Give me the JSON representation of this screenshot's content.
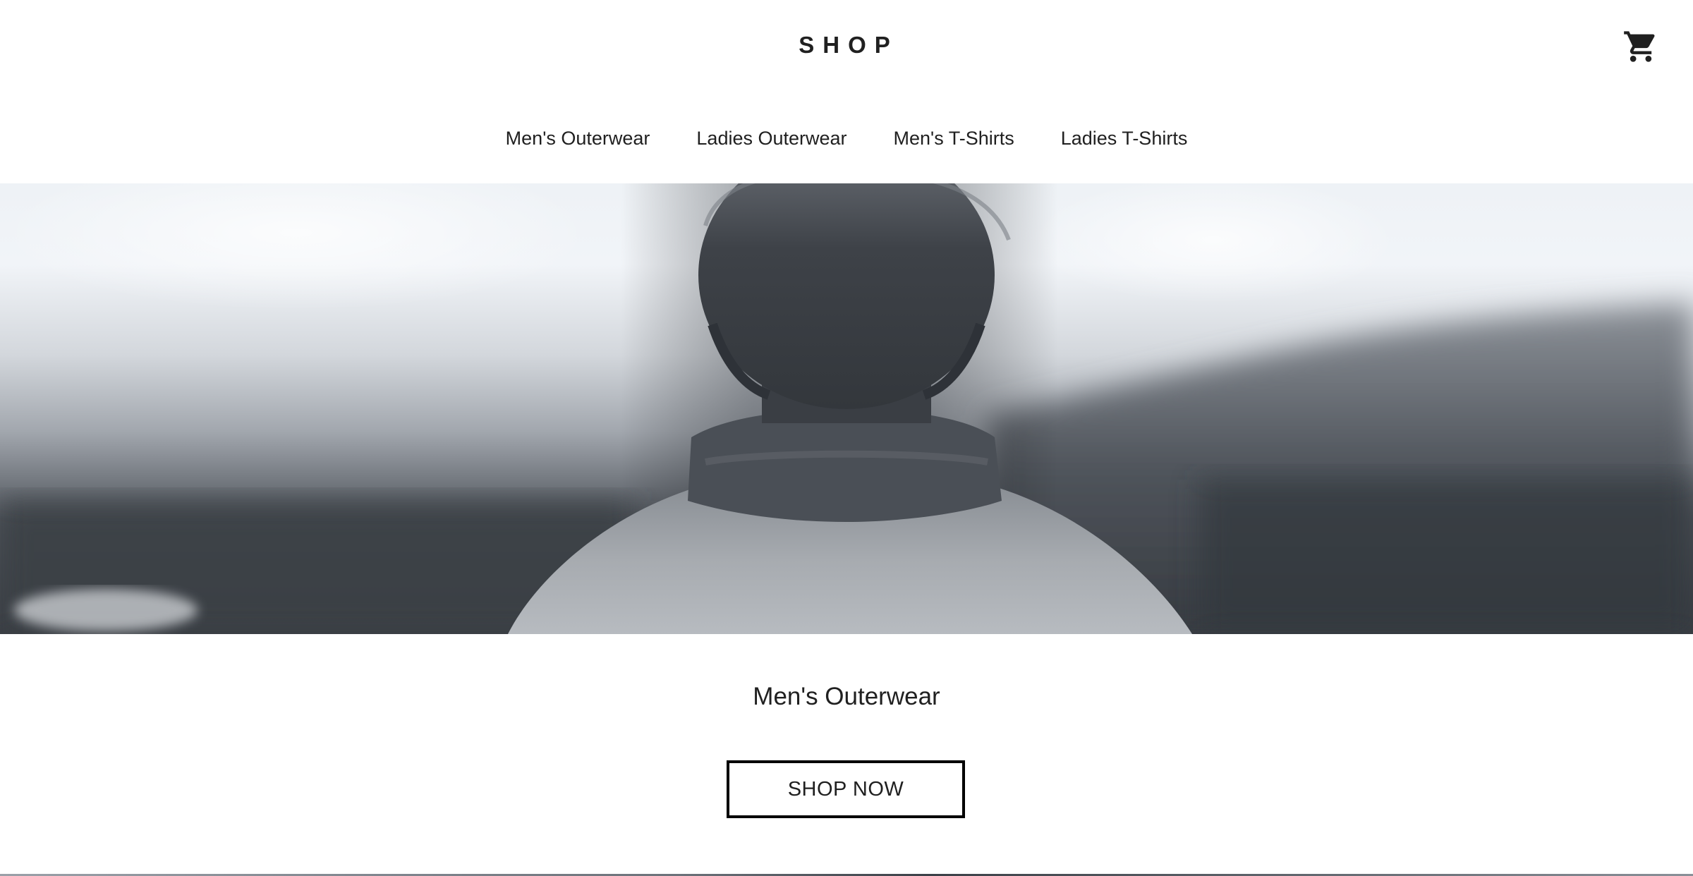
{
  "header": {
    "logo_text": "SHOP",
    "cart_icon": "cart-icon"
  },
  "nav": {
    "items": [
      {
        "label": "Men's Outerwear"
      },
      {
        "label": "Ladies Outerwear"
      },
      {
        "label": "Men's T-Shirts"
      },
      {
        "label": "Ladies T-Shirts"
      }
    ]
  },
  "hero": {
    "image_subject": "person-back-view-misty-landscape"
  },
  "category": {
    "title": "Men's Outerwear",
    "cta_label": "SHOP NOW"
  },
  "colors": {
    "text": "#202020",
    "button_border": "#000000",
    "background": "#ffffff"
  }
}
